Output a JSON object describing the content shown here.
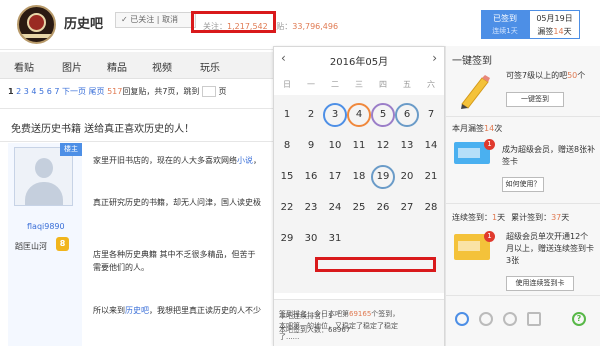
{
  "header": {
    "forum_name": "历史吧",
    "follow_text": "✓ 已关注 | 取消",
    "stats": {
      "follow_label": "关注：",
      "follow_count": "1,217,542",
      "post_label": "贴：",
      "post_count": "33,796,496"
    },
    "signed": {
      "label": "已签到",
      "sub": "连续1天"
    },
    "date": {
      "line1": "05月19日",
      "line2_prefix": "漏签",
      "line2_num": "14",
      "line2_suffix": "天"
    },
    "logo_text": "历史吧"
  },
  "nav": {
    "items": [
      "看贴",
      "图片",
      "精品",
      "视频",
      "玩乐"
    ]
  },
  "pager": {
    "pages": [
      "1",
      "2",
      "3",
      "4",
      "5",
      "6",
      "7"
    ],
    "next": "下一页",
    "last": "尾页",
    "reply_count": "517",
    "reply_text": "回复贴，共7页，跳到",
    "page_unit": "页"
  },
  "thread": {
    "title": "免费送历史书籍 送给真正喜欢历史的人！"
  },
  "post": {
    "ribbon": "楼主",
    "username": "flaqi9890",
    "level_name": "蹈匡山河",
    "level_num": "8",
    "lines": [
      {
        "text": "家里开旧书店的，现在的人大多喜欢网络",
        "link": "小说",
        "tail": "，"
      },
      {
        "text": "真正研究历史的书籍，却无人问津，国人读史极",
        "link": "",
        "tail": ""
      },
      {
        "text": "店里各种历史典籍 其中不乏很多精品，但苦于",
        "link": "",
        "tail": ""
      },
      {
        "text": "需要他们的人。",
        "link": "",
        "tail": ""
      },
      {
        "text": "所以来到",
        "link": "历史吧",
        "tail": "，我想把里真正读历史的人不少"
      }
    ]
  },
  "calendar": {
    "title": "2016年05月",
    "prev": "‹",
    "next": "›",
    "weekdays": [
      "日",
      "一",
      "二",
      "三",
      "四",
      "五",
      "六"
    ],
    "days": [
      "1",
      "2",
      "3",
      "4",
      "5",
      "6",
      "7",
      "8",
      "9",
      "10",
      "11",
      "12",
      "13",
      "14",
      "15",
      "16",
      "17",
      "18",
      "19",
      "20",
      "21",
      "22",
      "23",
      "24",
      "25",
      "26",
      "27",
      "28",
      "29",
      "30",
      "31"
    ],
    "circled_days": [
      {
        "day": "3",
        "color": "blue"
      },
      {
        "day": "4",
        "color": "orange"
      },
      {
        "day": "5",
        "color": "purple"
      },
      {
        "day": "6",
        "color": "teal"
      },
      {
        "day": "19",
        "color": "teal"
      }
    ],
    "info": {
      "rank_label": "签到排名：",
      "rank_text": "今日本吧第",
      "rank_num": "69165",
      "rank_tail": "个签到，",
      "rank_line2": "本吧第一的地位，又稳定了稳定了稳定",
      "rank_line3": "了......",
      "days_text": "本吧连续排名：1",
      "total_text": "本吧签到人数：68967"
    }
  },
  "right_panel": {
    "onekey": {
      "title": "一键签到",
      "text_prefix": "可签7级以上的吧",
      "num": "50",
      "unit": "个",
      "button": "一键签到"
    },
    "monthly": {
      "label": "本月漏签",
      "num": "14",
      "unit": "次",
      "text": "成为超级会员，赠送8张补签卡",
      "button": "如何使用？"
    },
    "streak": {
      "label": "连续签到：",
      "streak_num": "1",
      "streak_unit": "天",
      "total_label": "累计签到：",
      "total_num": "37",
      "total_unit": "天",
      "text": "超级会员单次开通12个月以上，赠送连续签到卡3张",
      "button": "使用连续签到卡"
    },
    "icons": [
      "refresh-icon",
      "circle-icon",
      "settings-icon",
      "checkbox-icon",
      "help-icon"
    ]
  },
  "colors": {
    "accent_blue": "#4d8fe6",
    "highlight_red": "#d9191b",
    "orange": "#e07a52"
  }
}
